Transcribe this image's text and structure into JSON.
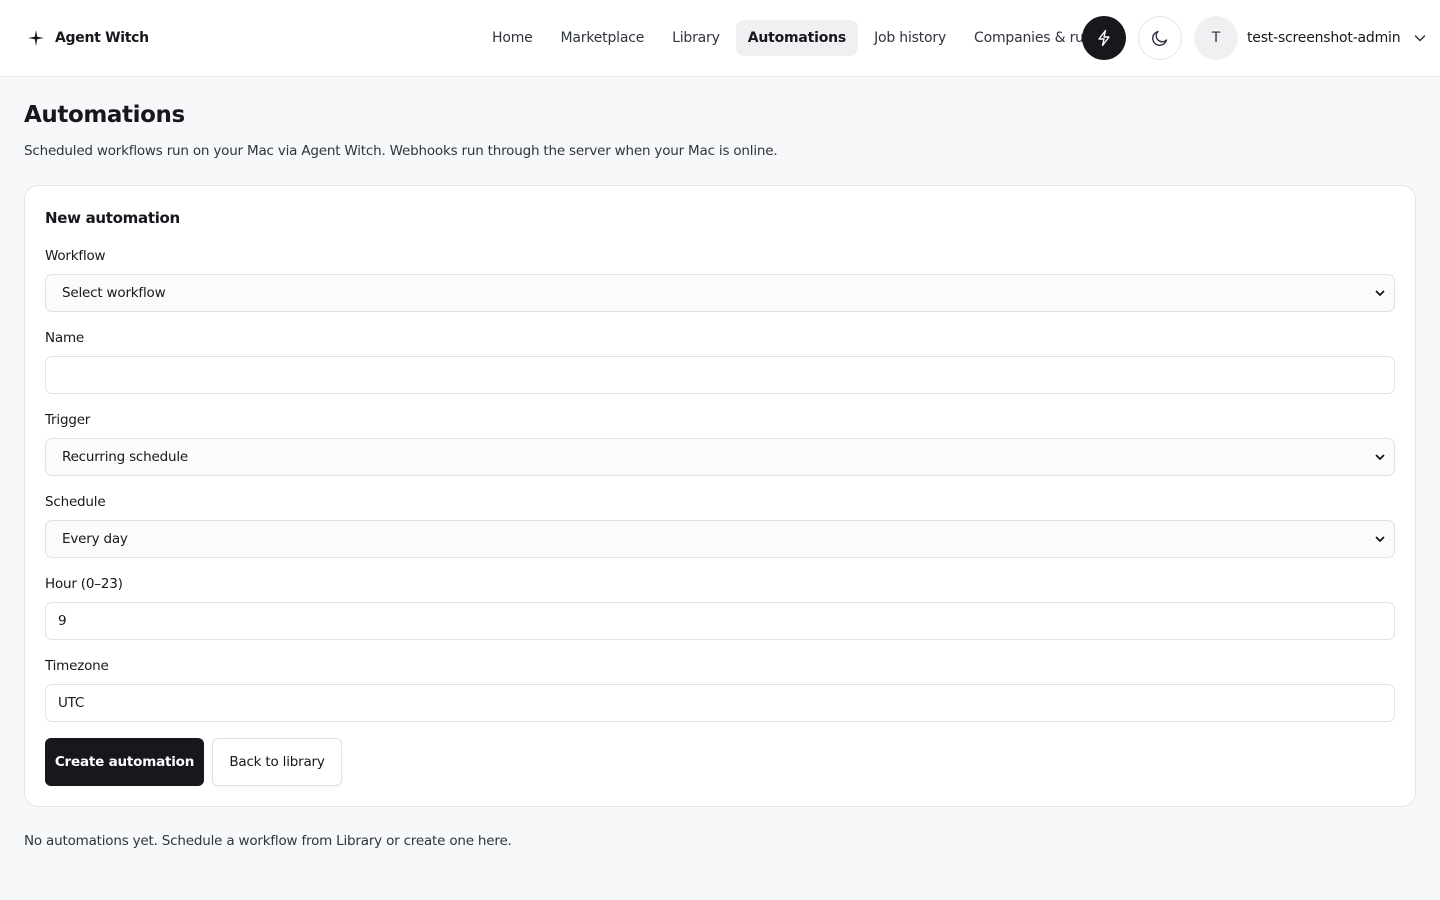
{
  "header": {
    "brand_name": "Agent Witch",
    "brand_icon": "sparkle-icon",
    "nav": [
      {
        "label": "Home"
      },
      {
        "label": "Marketplace"
      },
      {
        "label": "Library"
      },
      {
        "label": "Automations",
        "active": true
      },
      {
        "label": "Job history"
      },
      {
        "label": "Companies & rules"
      }
    ],
    "quick_action_icon": "lightning-bolt-icon",
    "theme_toggle_icon": "moon-icon",
    "user": {
      "avatar_initial": "T",
      "name": "test-screenshot-admin",
      "menu_icon": "chevron-down-icon"
    }
  },
  "page": {
    "title": "Automations",
    "subtitle": "Scheduled workflows run on your Mac via Agent Witch. Webhooks run through the server when your Mac is online."
  },
  "form": {
    "title": "New automation",
    "workflow": {
      "label": "Workflow",
      "value": "Select workflow"
    },
    "name": {
      "label": "Name",
      "value": "",
      "placeholder": ""
    },
    "trigger": {
      "label": "Trigger",
      "value": "Recurring schedule"
    },
    "schedule": {
      "label": "Schedule",
      "value": "Every day"
    },
    "hour": {
      "label": "Hour (0–23)",
      "value": "9"
    },
    "timezone": {
      "label": "Timezone",
      "value": "UTC"
    },
    "create_button": "Create automation",
    "back_button": "Back to library"
  },
  "empty_state": "No automations yet. Schedule a workflow from Library or create one here.",
  "colors": {
    "accent": "#16181d",
    "background": "#f7f8fa",
    "surface": "#ffffff",
    "border": "#e3e5e9",
    "active_nav": "#eff0f2"
  }
}
